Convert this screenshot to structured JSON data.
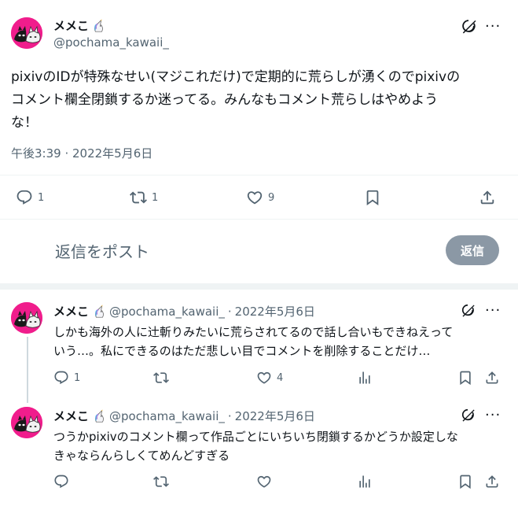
{
  "main_post": {
    "display_name": "メメこ",
    "handle": "@pochama_kawaii_",
    "text_line1": "pixivのIDが特殊なせい(マジこれだけ)で定期的に荒らしが湧くのでpixivの",
    "text_line2": "コメント欄全閉鎖するか迷ってる。みんなもコメント荒らしはやめよう",
    "text_line3": "な！",
    "timestamp": "午後3:39 · 2022年5月6日",
    "reply_count": "1",
    "repost_count": "1",
    "like_count": "9"
  },
  "composer": {
    "placeholder": "返信をポスト",
    "reply_button": "返信"
  },
  "replies": [
    {
      "display_name": "メメこ",
      "handle": "@pochama_kawaii_",
      "dot": "·",
      "date": "2022年5月6日",
      "text_line1": "しかも海外の人に辻斬りみたいに荒らされてるので話し合いもできねえって",
      "text_line2": "いう…。私にできるのはただ悲しい目でコメントを削除することだけ…",
      "reply_count": "1",
      "repost_count": "",
      "like_count": "4"
    },
    {
      "display_name": "メメこ",
      "handle": "@pochama_kawaii_",
      "dot": "·",
      "date": "2022年5月6日",
      "text_line1": "つうかpixivのコメント欄って作品ごとにいちいち閉鎖するかどうか設定しな",
      "text_line2": "きゃならんらしくてめんどすぎる",
      "reply_count": "",
      "repost_count": "",
      "like_count": ""
    }
  ],
  "icons": {
    "reply": "reply-icon",
    "repost": "repost-icon",
    "like": "heart-icon",
    "bookmark": "bookmark-icon",
    "share": "share-icon",
    "views": "views-icon",
    "grok": "grok-icon",
    "more": "more-icon",
    "unicorn": "unicorn-icon"
  },
  "colors": {
    "avatar_bg": "#f01d8c",
    "reply_button_bg": "#8b98a5",
    "secondary_text": "#536471"
  }
}
